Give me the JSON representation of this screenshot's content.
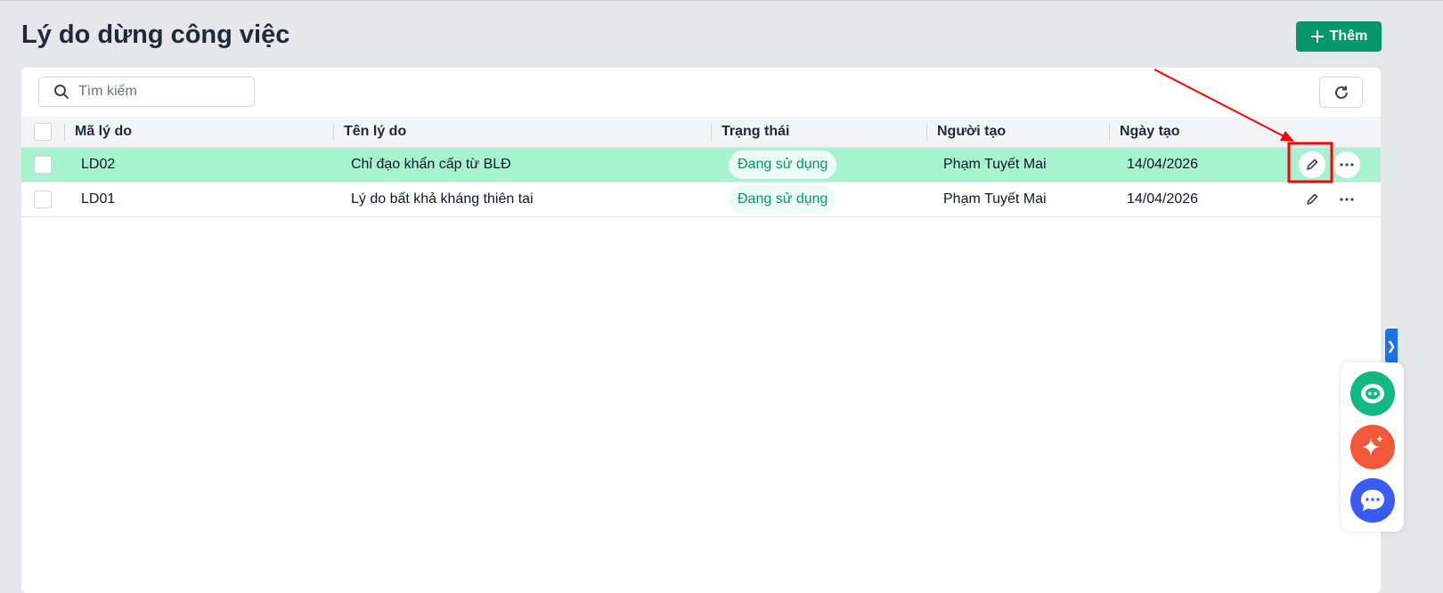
{
  "page": {
    "title": "Lý do dừng công việc",
    "add_label": "Thêm"
  },
  "search": {
    "placeholder": "Tìm kiếm",
    "value": ""
  },
  "table": {
    "columns": [
      "Mã lý do",
      "Tên lý do",
      "Trạng thái",
      "Người tạo",
      "Ngày tạo"
    ],
    "rows": [
      {
        "code": "LD02",
        "name": "Chỉ đạo khẩn cấp từ BLĐ",
        "status": "Đang sử dụng",
        "creator": "Phạm Tuyết Mai",
        "date": "14/04/2026",
        "selected": true
      },
      {
        "code": "LD01",
        "name": "Lý do bất khả kháng thiên tai",
        "status": "Đang sử dụng",
        "creator": "Phạm Tuyết Mai",
        "date": "14/04/2026",
        "selected": false
      }
    ]
  },
  "colors": {
    "accent": "#059669",
    "selected_row": "#a7f3d0",
    "annotation": "#ff0000"
  }
}
